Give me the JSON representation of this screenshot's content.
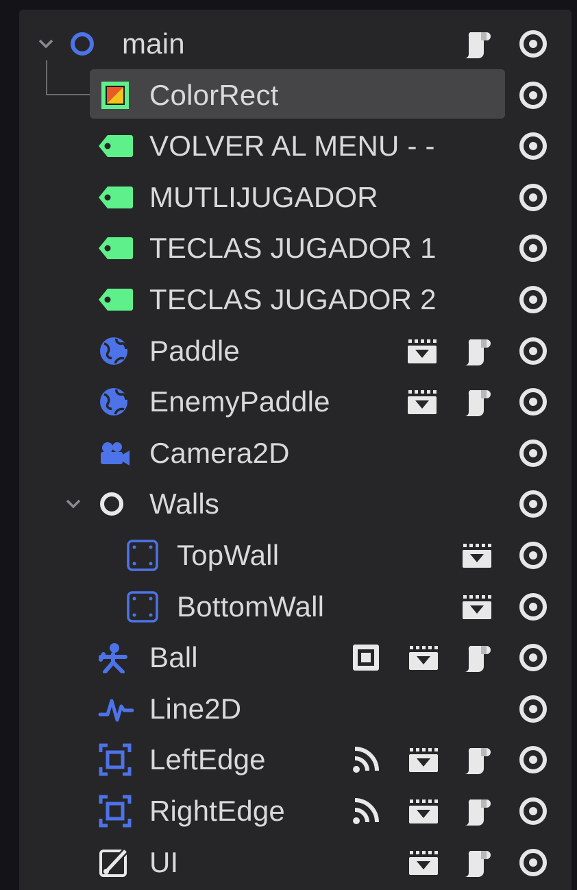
{
  "scene_tree": {
    "nodes": [
      {
        "name": "main",
        "type": "node2d",
        "expanded": true,
        "badges": [
          "script"
        ]
      },
      {
        "name": "ColorRect",
        "type": "colorrect",
        "selected": true,
        "badges": []
      },
      {
        "name": "VOLVER AL MENU - -",
        "type": "label",
        "badges": []
      },
      {
        "name": "MUTLIJUGADOR",
        "type": "label",
        "badges": []
      },
      {
        "name": "TECLAS JUGADOR 1",
        "type": "label",
        "badges": []
      },
      {
        "name": "TECLAS JUGADOR 2",
        "type": "label",
        "badges": []
      },
      {
        "name": "Paddle",
        "type": "area2d",
        "badges": [
          "scene",
          "script"
        ]
      },
      {
        "name": "EnemyPaddle",
        "type": "area2d",
        "badges": [
          "scene",
          "script"
        ]
      },
      {
        "name": "Camera2D",
        "type": "camera2d",
        "badges": []
      },
      {
        "name": "Walls",
        "type": "node2d",
        "expanded": true,
        "badges": []
      },
      {
        "name": "TopWall",
        "type": "collision",
        "badges": [
          "scene"
        ]
      },
      {
        "name": "BottomWall",
        "type": "collision",
        "badges": [
          "scene"
        ]
      },
      {
        "name": "Ball",
        "type": "characterbody",
        "badges": [
          "group",
          "scene",
          "script"
        ]
      },
      {
        "name": "Line2D",
        "type": "line2d",
        "badges": []
      },
      {
        "name": "LeftEdge",
        "type": "area",
        "badges": [
          "signal",
          "scene",
          "script"
        ]
      },
      {
        "name": "RightEdge",
        "type": "area",
        "badges": [
          "signal",
          "scene",
          "script"
        ]
      },
      {
        "name": "UI",
        "type": "canvaslayer",
        "badges": [
          "scene",
          "script"
        ]
      }
    ],
    "colors": {
      "panel_bg": "#262628",
      "selection_bg": "#454548",
      "text": "#d9d9dc",
      "node2d_blue": "#4d73e8",
      "label_green": "#5ef08a",
      "eye_white": "#e6e6e6"
    }
  }
}
